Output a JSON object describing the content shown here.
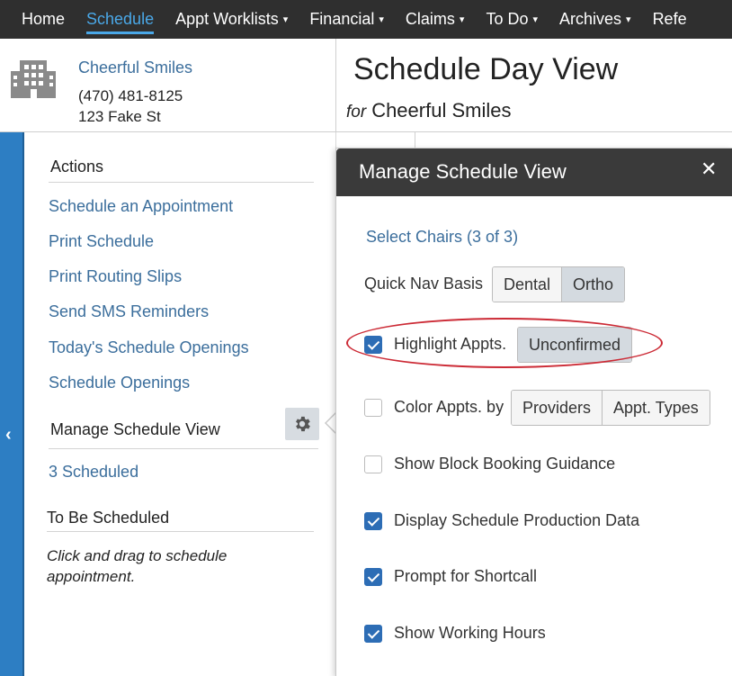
{
  "nav": {
    "items": [
      {
        "label": "Home",
        "dropdown": false
      },
      {
        "label": "Schedule",
        "dropdown": false,
        "active": true
      },
      {
        "label": "Appt Worklists",
        "dropdown": true
      },
      {
        "label": "Financial",
        "dropdown": true
      },
      {
        "label": "Claims",
        "dropdown": true
      },
      {
        "label": "To Do",
        "dropdown": true
      },
      {
        "label": "Archives",
        "dropdown": true
      },
      {
        "label": "Refe",
        "dropdown": false
      }
    ],
    "caret": "▾"
  },
  "practice": {
    "name": "Cheerful Smiles",
    "phone": "(470) 481-8125",
    "address": "123 Fake St"
  },
  "header": {
    "title": "Schedule Day View",
    "for_label": "for",
    "practice_name": "Cheerful Smiles"
  },
  "sidebar": {
    "collapse_glyph": "‹",
    "actions_heading": "Actions",
    "actions": [
      "Schedule an Appointment",
      "Print Schedule",
      "Print Routing Slips",
      "Send SMS Reminders",
      "Today's Schedule Openings",
      "Schedule Openings"
    ],
    "manage_heading": "Manage Schedule View",
    "scheduled_link": "3 Scheduled",
    "to_be_scheduled_heading": "To Be Scheduled",
    "to_be_scheduled_note": "Click and drag to schedule appointment."
  },
  "popover": {
    "title": "Manage Schedule View",
    "close_glyph": "✕",
    "select_chairs": "Select Chairs (3 of 3)",
    "quick_nav_label": "Quick Nav Basis",
    "quick_nav_options": [
      "Dental",
      "Ortho"
    ],
    "quick_nav_selected": "Ortho",
    "highlight_label": "Highlight Appts.",
    "highlight_checked": true,
    "highlight_option": "Unconfirmed",
    "color_label": "Color Appts. by",
    "color_checked": false,
    "color_options": [
      "Providers",
      "Appt. Types"
    ],
    "options": [
      {
        "label": "Show Block Booking Guidance",
        "checked": false
      },
      {
        "label": "Display Schedule Production Data",
        "checked": true
      },
      {
        "label": "Prompt for Shortcall",
        "checked": true
      },
      {
        "label": "Show Working Hours",
        "checked": true
      }
    ]
  },
  "colors": {
    "nav_bg": "#2f2f2f",
    "accent": "#4aa8e8",
    "link": "#3b6e9c",
    "checkbox": "#2d6db5",
    "annotation": "#cc2b36"
  }
}
